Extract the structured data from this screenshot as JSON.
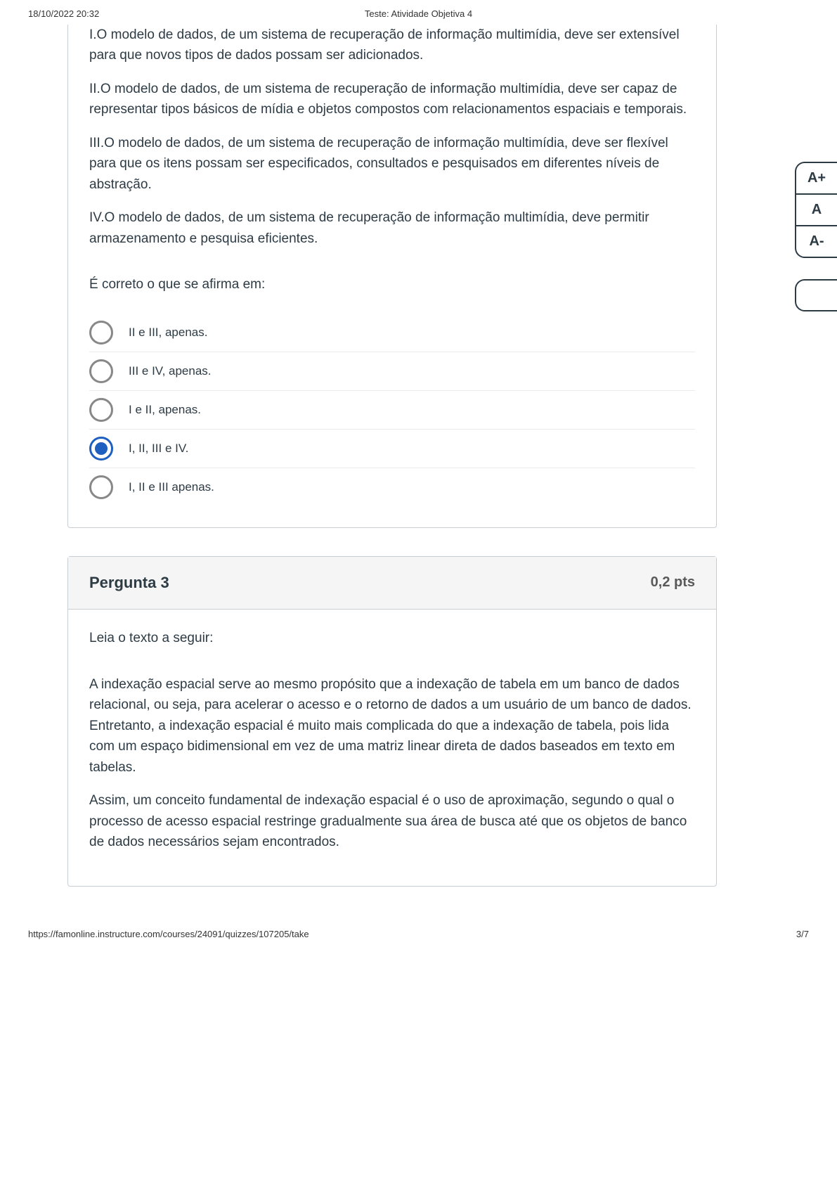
{
  "header": {
    "timestamp": "18/10/2022 20:32",
    "title": "Teste: Atividade Objetiva 4"
  },
  "q2": {
    "statements": [
      "I.O modelo de dados, de um sistema de recuperação de informação multimídia, deve ser extensível para que novos tipos de dados possam ser adicionados.",
      "II.O modelo de dados, de um sistema de recuperação de informação multimídia, deve ser capaz de representar tipos básicos de mídia e objetos compostos com relacionamentos espaciais e temporais.",
      "III.O modelo de dados, de um sistema de recuperação de informação multimídia, deve ser flexível para que os itens possam ser especificados, consultados e pesquisados em diferentes níveis de abstração.",
      "IV.O modelo de dados, de um sistema de recuperação de informação multimídia, deve permitir armazenamento e pesquisa eficientes."
    ],
    "prompt": "É correto o que se afirma em:",
    "options": [
      {
        "label": "II e III, apenas.",
        "selected": false
      },
      {
        "label": "III e IV, apenas.",
        "selected": false
      },
      {
        "label": "I e II, apenas.",
        "selected": false
      },
      {
        "label": "I, II, III e IV.",
        "selected": true
      },
      {
        "label": "I, II e III apenas.",
        "selected": false
      }
    ]
  },
  "q3": {
    "title": "Pergunta 3",
    "points": "0,2 pts",
    "lead": "Leia o texto a seguir:",
    "paragraphs": [
      "A indexação espacial serve ao mesmo propósito que a indexação de tabela em um banco de dados relacional, ou seja, para acelerar o acesso e o retorno de dados a um usuário de um banco de dados. Entretanto, a indexação espacial é muito mais complicada do que a indexação de tabela, pois lida com um espaço bidimensional em vez de uma matriz linear direta de dados baseados em texto em tabelas.",
      "Assim, um conceito fundamental de indexação espacial é o uso de aproximação, segundo o qual o processo de acesso espacial restringe gradualmente sua área de busca até que os objetos de banco de dados necessários sejam encontrados."
    ]
  },
  "sidetools": {
    "increase": "A+",
    "normal": "A",
    "decrease": "A-"
  },
  "footer": {
    "url": "https://famonline.instructure.com/courses/24091/quizzes/107205/take",
    "page": "3/7"
  }
}
